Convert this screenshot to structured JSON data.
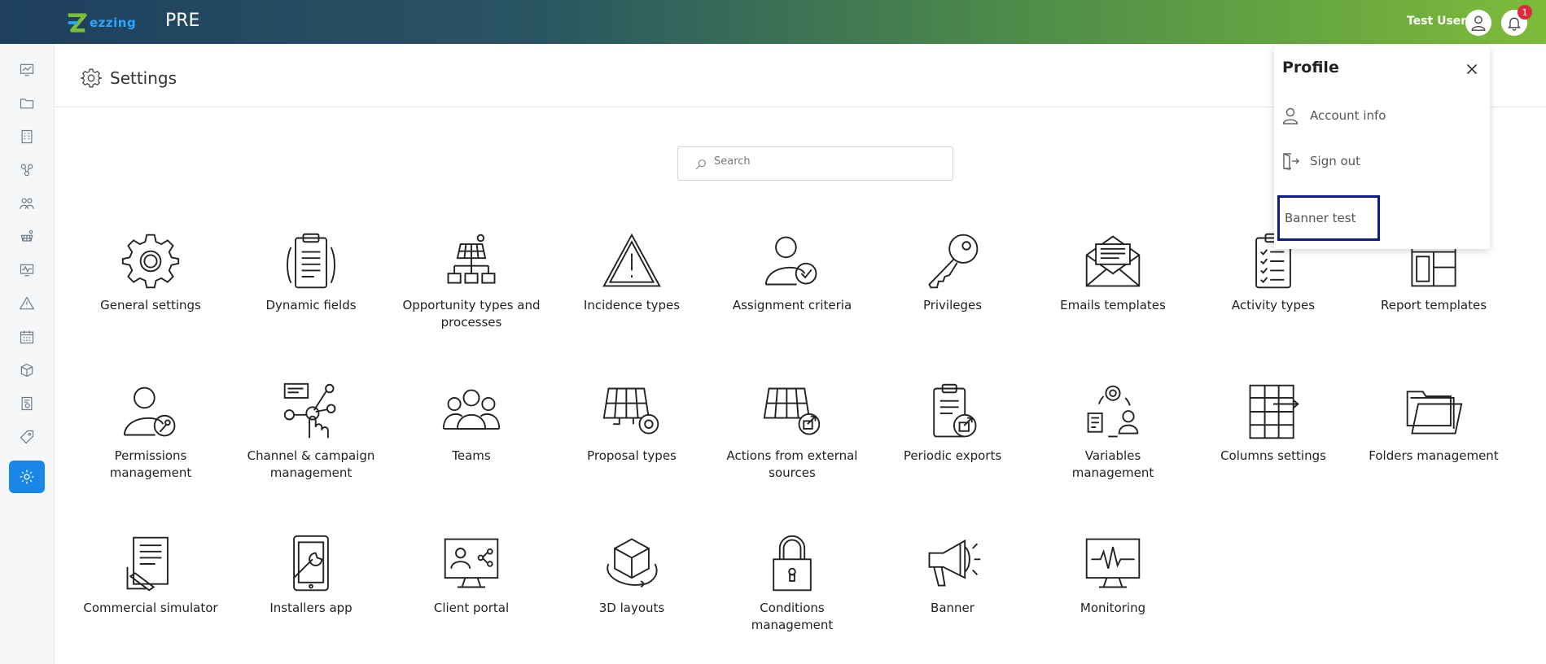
{
  "topbar": {
    "logo_text": "ezzing",
    "environment": "PRE",
    "user_name": "Test User",
    "notification_count": "1"
  },
  "sidebar": {
    "items": [
      {
        "icon": "dashboard-icon"
      },
      {
        "icon": "folder-icon"
      },
      {
        "icon": "building-icon"
      },
      {
        "icon": "people-network-icon"
      },
      {
        "icon": "users-group-icon"
      },
      {
        "icon": "solar-panel-icon"
      },
      {
        "icon": "monitor-chart-icon"
      },
      {
        "icon": "warning-icon"
      },
      {
        "icon": "calendar-icon"
      },
      {
        "icon": "cube-icon"
      },
      {
        "icon": "money-document-icon"
      },
      {
        "icon": "tag-icon"
      },
      {
        "icon": "settings-icon",
        "active": true
      }
    ]
  },
  "page": {
    "title": "Settings"
  },
  "search": {
    "placeholder": "Search"
  },
  "tiles": [
    {
      "label": "General settings",
      "icon": "gear-icon"
    },
    {
      "label": "Dynamic fields",
      "icon": "clipboard-icon"
    },
    {
      "label": "Opportunity types and processes",
      "icon": "solar-hierarchy-icon"
    },
    {
      "label": "Incidence types",
      "icon": "warning-triangle-icon"
    },
    {
      "label": "Assignment criteria",
      "icon": "user-check-icon"
    },
    {
      "label": "Privileges",
      "icon": "key-icon"
    },
    {
      "label": "Emails templates",
      "icon": "envelope-icon"
    },
    {
      "label": "Activity types",
      "icon": "checklist-icon"
    },
    {
      "label": "Report templates",
      "icon": "layout-icon"
    },
    {
      "label": "Permissions management",
      "icon": "user-key-icon"
    },
    {
      "label": "Channel & campaign management",
      "icon": "touch-network-icon"
    },
    {
      "label": "Teams",
      "icon": "team-icon"
    },
    {
      "label": "Proposal types",
      "icon": "solar-gear-icon"
    },
    {
      "label": "Actions from external sources",
      "icon": "solar-external-icon"
    },
    {
      "label": "Periodic exports",
      "icon": "clipboard-export-icon"
    },
    {
      "label": "Variables management",
      "icon": "variables-cycle-icon"
    },
    {
      "label": "Columns settings",
      "icon": "columns-grid-icon"
    },
    {
      "label": "Folders management",
      "icon": "folders-icon"
    },
    {
      "label": "Commercial simulator",
      "icon": "document-pencil-icon"
    },
    {
      "label": "Installers app",
      "icon": "tablet-wrench-icon"
    },
    {
      "label": "Client portal",
      "icon": "monitor-share-icon"
    },
    {
      "label": "3D layouts",
      "icon": "cube-rotate-icon"
    },
    {
      "label": "Conditions management",
      "icon": "padlock-icon"
    },
    {
      "label": "Banner",
      "icon": "megaphone-icon"
    },
    {
      "label": "Monitoring",
      "icon": "monitor-pulse-icon"
    }
  ],
  "profile": {
    "title": "Profile",
    "account_info": "Account info",
    "sign_out": "Sign out",
    "banner_test": "Banner test"
  }
}
